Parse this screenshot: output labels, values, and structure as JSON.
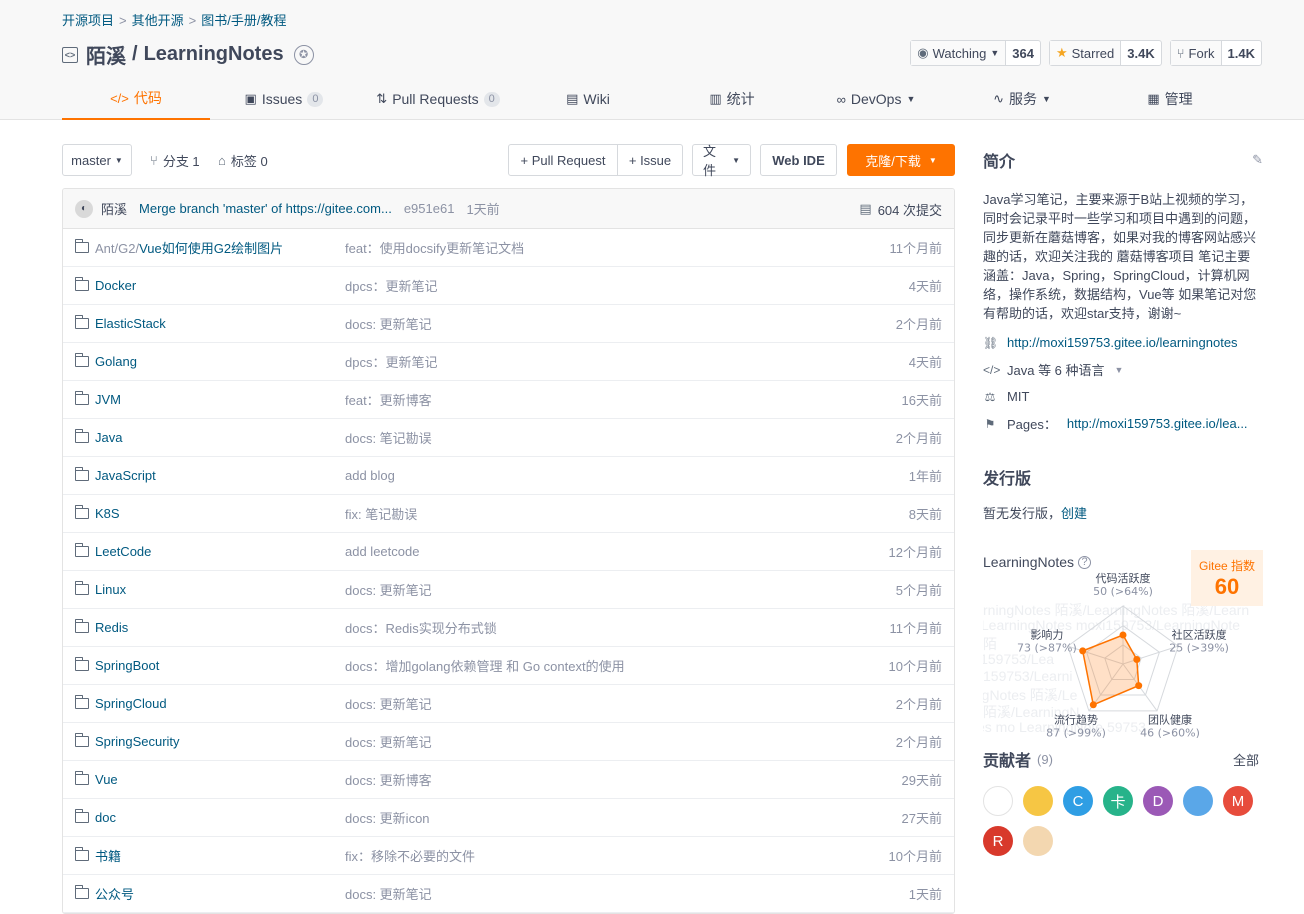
{
  "breadcrumb": [
    "开源项目",
    "其他开源",
    "图书/手册/教程"
  ],
  "repo": {
    "owner": "陌溪",
    "sep": "/",
    "name": "LearningNotes"
  },
  "actions": {
    "watch": {
      "label": "Watching",
      "count": "364"
    },
    "star": {
      "label": "Starred",
      "count": "3.4K"
    },
    "fork": {
      "label": "Fork",
      "count": "1.4K"
    }
  },
  "tabs": [
    {
      "label": "代码",
      "count": ""
    },
    {
      "label": "Issues",
      "count": "0"
    },
    {
      "label": "Pull Requests",
      "count": "0"
    },
    {
      "label": "Wiki",
      "count": ""
    },
    {
      "label": "统计",
      "count": ""
    },
    {
      "label": "DevOps",
      "count": ""
    },
    {
      "label": "服务",
      "count": ""
    },
    {
      "label": "管理",
      "count": ""
    }
  ],
  "toolbar": {
    "branch": "master",
    "branches_label": "分支 1",
    "tags_label": "标签 0",
    "pull_request": "+ Pull Request",
    "issue": "+ Issue",
    "file": "文件",
    "web_ide": "Web IDE",
    "clone": "克隆/下载"
  },
  "last_commit": {
    "author": "陌溪",
    "message": "Merge branch 'master' of https://gitee.com...",
    "sha": "e951e61",
    "time": "1天前",
    "total": "604 次提交"
  },
  "files": [
    {
      "prefix": "Ant/G2/",
      "name": "Vue如何使用G2绘制图片",
      "message": "feat：使用docsify更新笔记文档",
      "time": "11个月前"
    },
    {
      "prefix": "",
      "name": "Docker",
      "message": "dpcs：更新笔记",
      "time": "4天前"
    },
    {
      "prefix": "",
      "name": "ElasticStack",
      "message": "docs: 更新笔记",
      "time": "2个月前"
    },
    {
      "prefix": "",
      "name": "Golang",
      "message": "dpcs：更新笔记",
      "time": "4天前"
    },
    {
      "prefix": "",
      "name": "JVM",
      "message": "feat：更新博客",
      "time": "16天前"
    },
    {
      "prefix": "",
      "name": "Java",
      "message": "docs: 笔记勘误",
      "time": "2个月前"
    },
    {
      "prefix": "",
      "name": "JavaScript",
      "message": "add blog",
      "time": "1年前"
    },
    {
      "prefix": "",
      "name": "K8S",
      "message": "fix: 笔记勘误",
      "time": "8天前"
    },
    {
      "prefix": "",
      "name": "LeetCode",
      "message": "add leetcode",
      "time": "12个月前"
    },
    {
      "prefix": "",
      "name": "Linux",
      "message": "docs: 更新笔记",
      "time": "5个月前"
    },
    {
      "prefix": "",
      "name": "Redis",
      "message": "docs：Redis实现分布式锁",
      "time": "11个月前"
    },
    {
      "prefix": "",
      "name": "SpringBoot",
      "message": "docs：增加golang依赖管理 和 Go context的使用",
      "time": "10个月前"
    },
    {
      "prefix": "",
      "name": "SpringCloud",
      "message": "docs: 更新笔记",
      "time": "2个月前"
    },
    {
      "prefix": "",
      "name": "SpringSecurity",
      "message": "docs: 更新笔记",
      "time": "2个月前"
    },
    {
      "prefix": "",
      "name": "Vue",
      "message": "docs: 更新博客",
      "time": "29天前"
    },
    {
      "prefix": "",
      "name": "doc",
      "message": "docs: 更新icon",
      "time": "27天前"
    },
    {
      "prefix": "",
      "name": "书籍",
      "message": "fix：移除不必要的文件",
      "time": "10个月前"
    },
    {
      "prefix": "",
      "name": "公众号",
      "message": "docs: 更新笔记",
      "time": "1天前"
    }
  ],
  "sidebar": {
    "intro_title": "简介",
    "description": "Java学习笔记，主要来源于B站上视频的学习，同时会记录平时一些学习和项目中遇到的问题，同步更新在蘑菇博客，如果对我的博客网站感兴趣的话，欢迎关注我的 蘑菇博客项目 笔记主要涵盖：Java，Spring，SpringCloud，计算机网络，操作系统，数据结构，Vue等 如果笔记对您有帮助的话，欢迎star支持，谢谢~",
    "homepage": "http://moxi159753.gitee.io/learningnotes",
    "languages": "Java 等 6 种语言",
    "license": "MIT",
    "pages_label": "Pages：",
    "pages_url": "http://moxi159753.gitee.io/lea...",
    "release_title": "发行版",
    "release_text": "暂无发行版，",
    "release_create": "创建",
    "index_repo": "LearningNotes",
    "gitee_index_label": "Gitee 指数",
    "gitee_index_value": "60",
    "watermark": [
      "rningNotes 陌溪/LearningNotes 陌溪/Learn",
      "/LearningNotes moxi159753/LearningNote",
      "陌 ",
      "i159753/Lea ",
      "159753/Learni",
      "rgNotes 陌溪/Le",
      "陌溪/LearningN",
      "es mo LearningNote 59753"
    ],
    "radar": [
      {
        "name": "代码活跃度",
        "value": "50 (>64%)",
        "score": 50
      },
      {
        "name": "社区活跃度",
        "value": "25 (>39%)",
        "score": 25
      },
      {
        "name": "团队健康",
        "value": "46 (>60%)",
        "score": 46
      },
      {
        "name": "流行趋势",
        "value": "87 (>99%)",
        "score": 87
      },
      {
        "name": "影响力",
        "value": "73 (>87%)",
        "score": 73
      }
    ],
    "contributors_title": "贡献者",
    "contributors_count": "(9)",
    "contributors_all": "全部",
    "contributors": [
      {
        "letter": "",
        "color": "#ffffff"
      },
      {
        "letter": "",
        "color": "#f6c644"
      },
      {
        "letter": "C",
        "color": "#2f9ee4"
      },
      {
        "letter": "卡",
        "color": "#27b38a"
      },
      {
        "letter": "D",
        "color": "#9b59b6"
      },
      {
        "letter": "",
        "color": "#5aa7e8"
      },
      {
        "letter": "M",
        "color": "#e74c3c"
      },
      {
        "letter": "R",
        "color": "#d8392b"
      },
      {
        "letter": "",
        "color": "#f3d7b0"
      }
    ]
  },
  "colors": {
    "accent": "#fe7300",
    "link": "#005980",
    "text": "#40485b",
    "muted": "#8c92a4"
  }
}
